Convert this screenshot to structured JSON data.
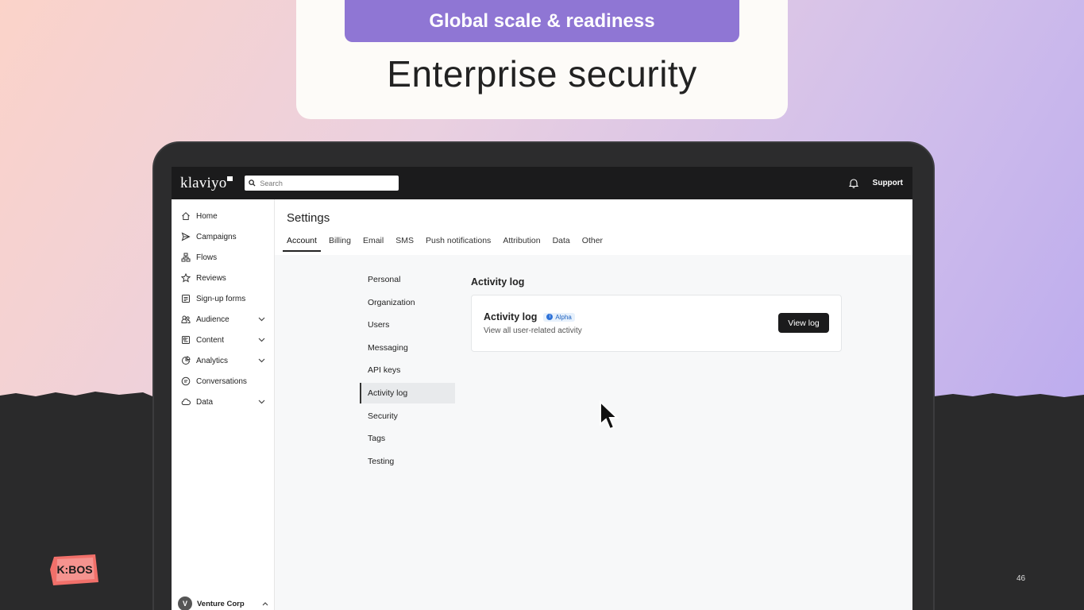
{
  "slide": {
    "banner": "Global scale & readiness",
    "headline": "Enterprise security",
    "page_number": "46",
    "logo_text": "K:BOS"
  },
  "app": {
    "logo": "klaviyo",
    "search_placeholder": "Search",
    "support_label": "Support"
  },
  "sidebar": {
    "items": [
      {
        "label": "Home",
        "icon": "home-icon",
        "expandable": false
      },
      {
        "label": "Campaigns",
        "icon": "send-icon",
        "expandable": false
      },
      {
        "label": "Flows",
        "icon": "flows-icon",
        "expandable": false
      },
      {
        "label": "Reviews",
        "icon": "star-icon",
        "expandable": false
      },
      {
        "label": "Sign-up forms",
        "icon": "form-icon",
        "expandable": false
      },
      {
        "label": "Audience",
        "icon": "people-icon",
        "expandable": true
      },
      {
        "label": "Content",
        "icon": "content-icon",
        "expandable": true
      },
      {
        "label": "Analytics",
        "icon": "pie-icon",
        "expandable": true
      },
      {
        "label": "Conversations",
        "icon": "chat-icon",
        "expandable": false
      },
      {
        "label": "Data",
        "icon": "cloud-icon",
        "expandable": true
      }
    ],
    "account": {
      "initial": "V",
      "name": "Venture Corp"
    }
  },
  "settings": {
    "title": "Settings",
    "tabs": [
      "Account",
      "Billing",
      "Email",
      "SMS",
      "Push notifications",
      "Attribution",
      "Data",
      "Other"
    ],
    "active_tab": "Account",
    "subnav": [
      "Personal",
      "Organization",
      "Users",
      "Messaging",
      "API keys",
      "Activity log",
      "Security",
      "Tags",
      "Testing"
    ],
    "active_subnav": "Activity log",
    "section_title": "Activity log",
    "card": {
      "title": "Activity log",
      "badge": "Alpha",
      "subtitle": "View all user-related activity",
      "button": "View log"
    }
  }
}
